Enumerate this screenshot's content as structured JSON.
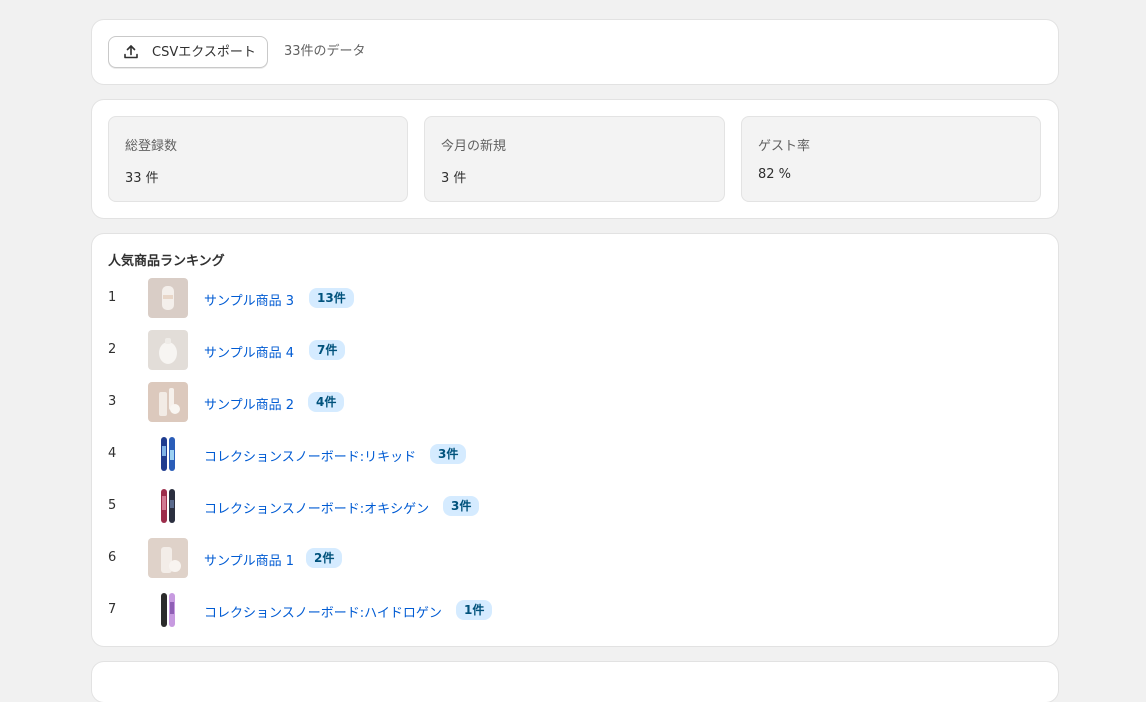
{
  "toolbar": {
    "export_label": "CSVエクスポート",
    "data_count": "33件のデータ"
  },
  "stats": [
    {
      "label": "総登録数",
      "value": "33 件"
    },
    {
      "label": "今月の新規",
      "value": "3 件"
    },
    {
      "label": "ゲスト率",
      "value": "82 %"
    }
  ],
  "ranking": {
    "title": "人気商品ランキング",
    "items": [
      {
        "rank": "1",
        "name": "サンプル商品 3",
        "count": "13件",
        "thumb": "sample-product-image"
      },
      {
        "rank": "2",
        "name": "サンプル商品 4",
        "count": "7件",
        "thumb": "sample-product-image"
      },
      {
        "rank": "3",
        "name": "サンプル商品 2",
        "count": "4件",
        "thumb": "sample-product-image"
      },
      {
        "rank": "4",
        "name": "コレクションスノーボード:リキッド",
        "count": "3件",
        "thumb": "snowboard-image"
      },
      {
        "rank": "5",
        "name": "コレクションスノーボード:オキシゲン",
        "count": "3件",
        "thumb": "snowboard-image"
      },
      {
        "rank": "6",
        "name": "サンプル商品 1",
        "count": "2件",
        "thumb": "sample-product-image"
      },
      {
        "rank": "7",
        "name": "コレクションスノーボード:ハイドロゲン",
        "count": "1件",
        "thumb": "snowboard-image"
      }
    ]
  },
  "colors": {
    "link": "#005bd3",
    "badge_bg": "#d5ebff",
    "badge_text": "#00527c",
    "page_bg": "#f1f1f1"
  },
  "icons": {
    "export": "upload-icon"
  }
}
